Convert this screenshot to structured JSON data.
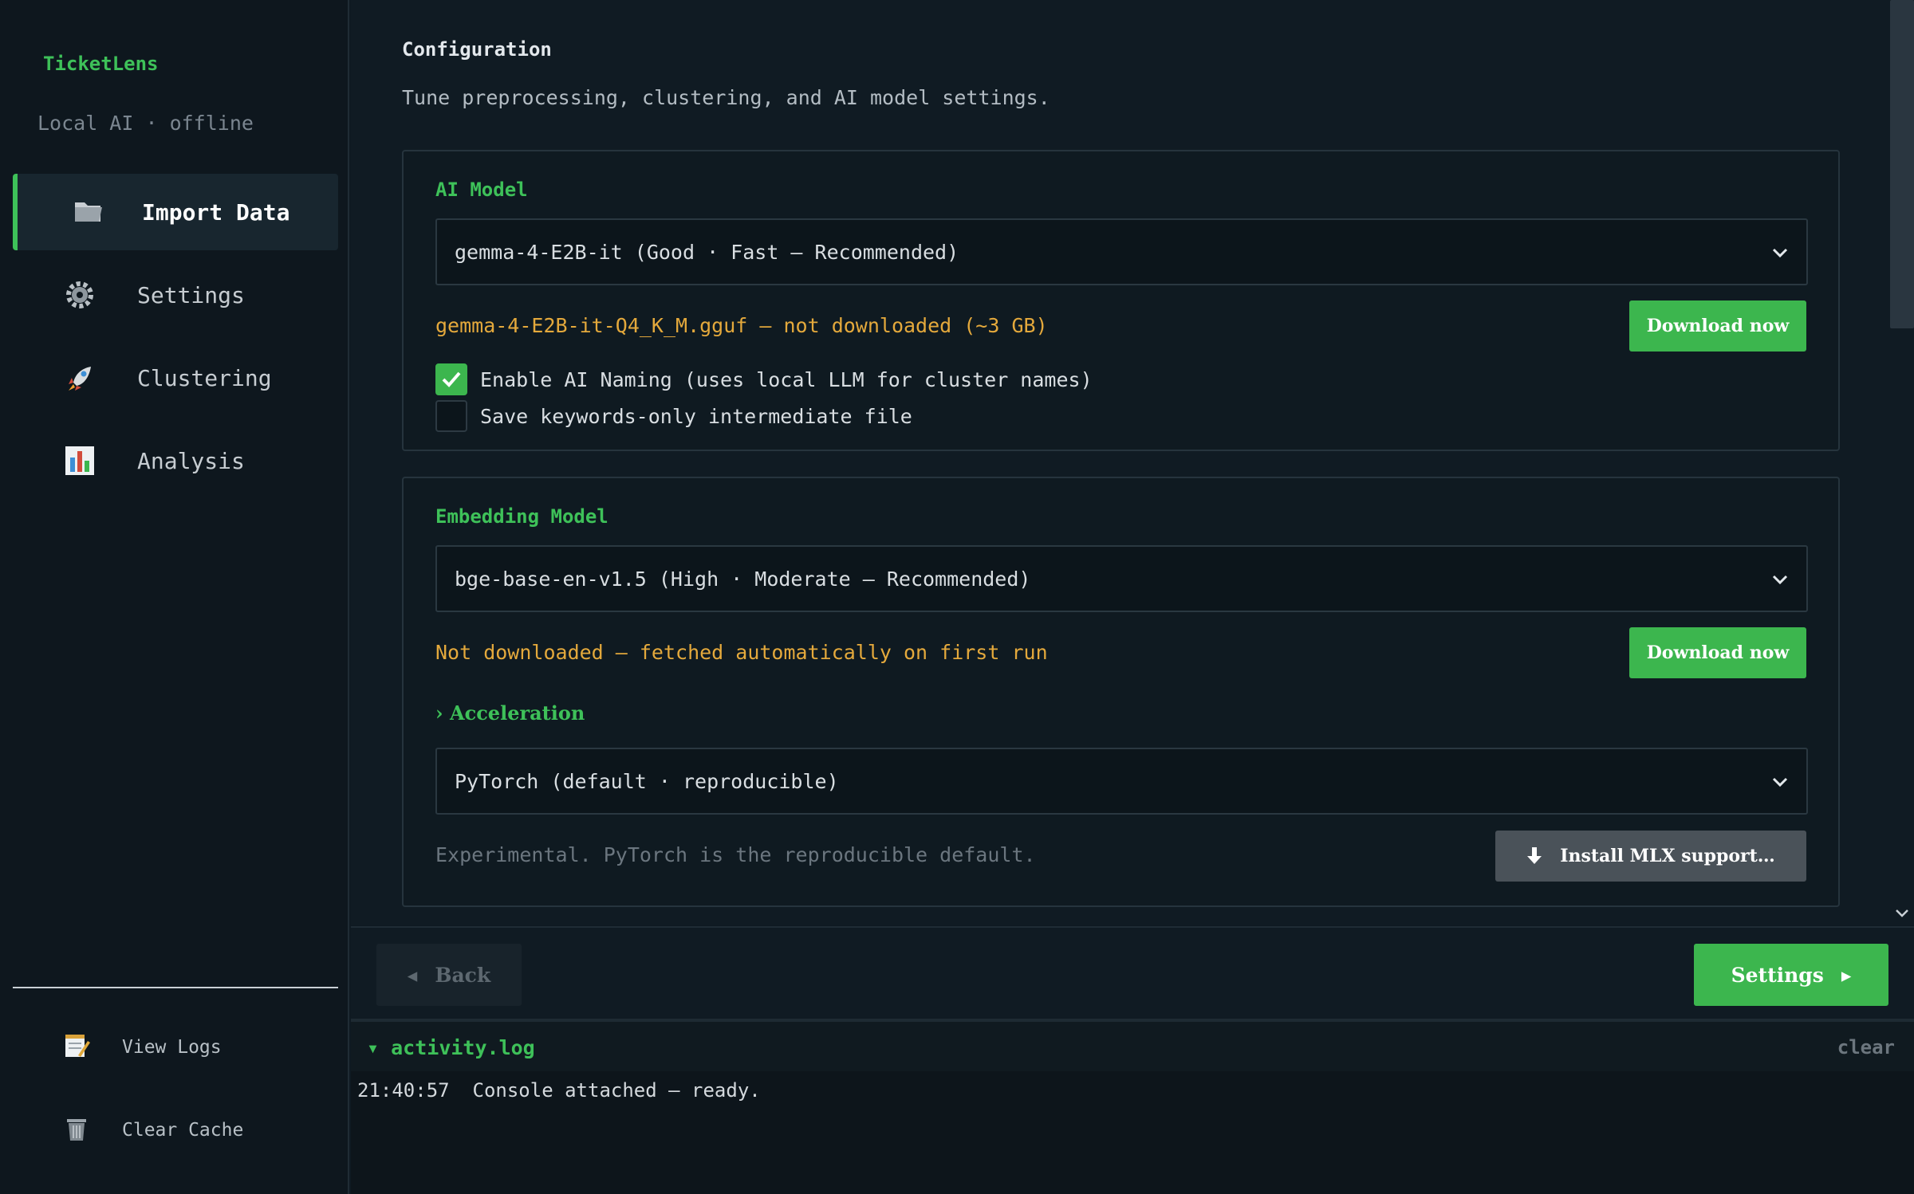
{
  "sidebar": {
    "brand": "TicketLens",
    "subtitle": "Local AI · offline",
    "items": [
      {
        "label": "Import Data",
        "icon": "folder-icon",
        "active": true
      },
      {
        "label": "Settings",
        "icon": "gear-icon"
      },
      {
        "label": "Clustering",
        "icon": "rocket-icon"
      },
      {
        "label": "Analysis",
        "icon": "bar-chart-icon"
      }
    ],
    "bottom": [
      {
        "label": "View Logs",
        "icon": "notepad-icon"
      },
      {
        "label": "Clear Cache",
        "icon": "trash-icon"
      }
    ]
  },
  "main": {
    "title": "Configuration",
    "subtitle": "Tune preprocessing, clustering, and AI model settings.",
    "ai_model": {
      "title": "AI Model",
      "selected": "gemma-4-E2B-it (Good · Fast — Recommended)",
      "status": "gemma-4-E2B-it-Q4_K_M.gguf — not downloaded (~3 GB)",
      "download_label": "Download now",
      "enable_naming": {
        "label": "Enable AI Naming (uses local LLM for cluster names)",
        "checked": true
      },
      "save_keywords": {
        "label": "Save keywords-only intermediate file",
        "checked": false
      }
    },
    "embedding_model": {
      "title": "Embedding Model",
      "selected": "bge-base-en-v1.5 (High · Moderate — Recommended)",
      "status": "Not downloaded — fetched automatically on first run",
      "download_label": "Download now",
      "acceleration_label": "Acceleration",
      "acceleration_selected": "PyTorch (default · reproducible)",
      "acceleration_note": "Experimental. PyTorch is the reproducible default.",
      "install_label": "Install MLX support…"
    }
  },
  "footer": {
    "back_label": "Back",
    "next_label": "Settings"
  },
  "log": {
    "title": "activity.log",
    "clear_label": "clear",
    "lines": [
      {
        "time": "21:40:57",
        "message": "Console attached — ready."
      }
    ]
  },
  "colors": {
    "accent": "#3cb64e",
    "warning": "#e4a93c",
    "background": "#101b23"
  }
}
